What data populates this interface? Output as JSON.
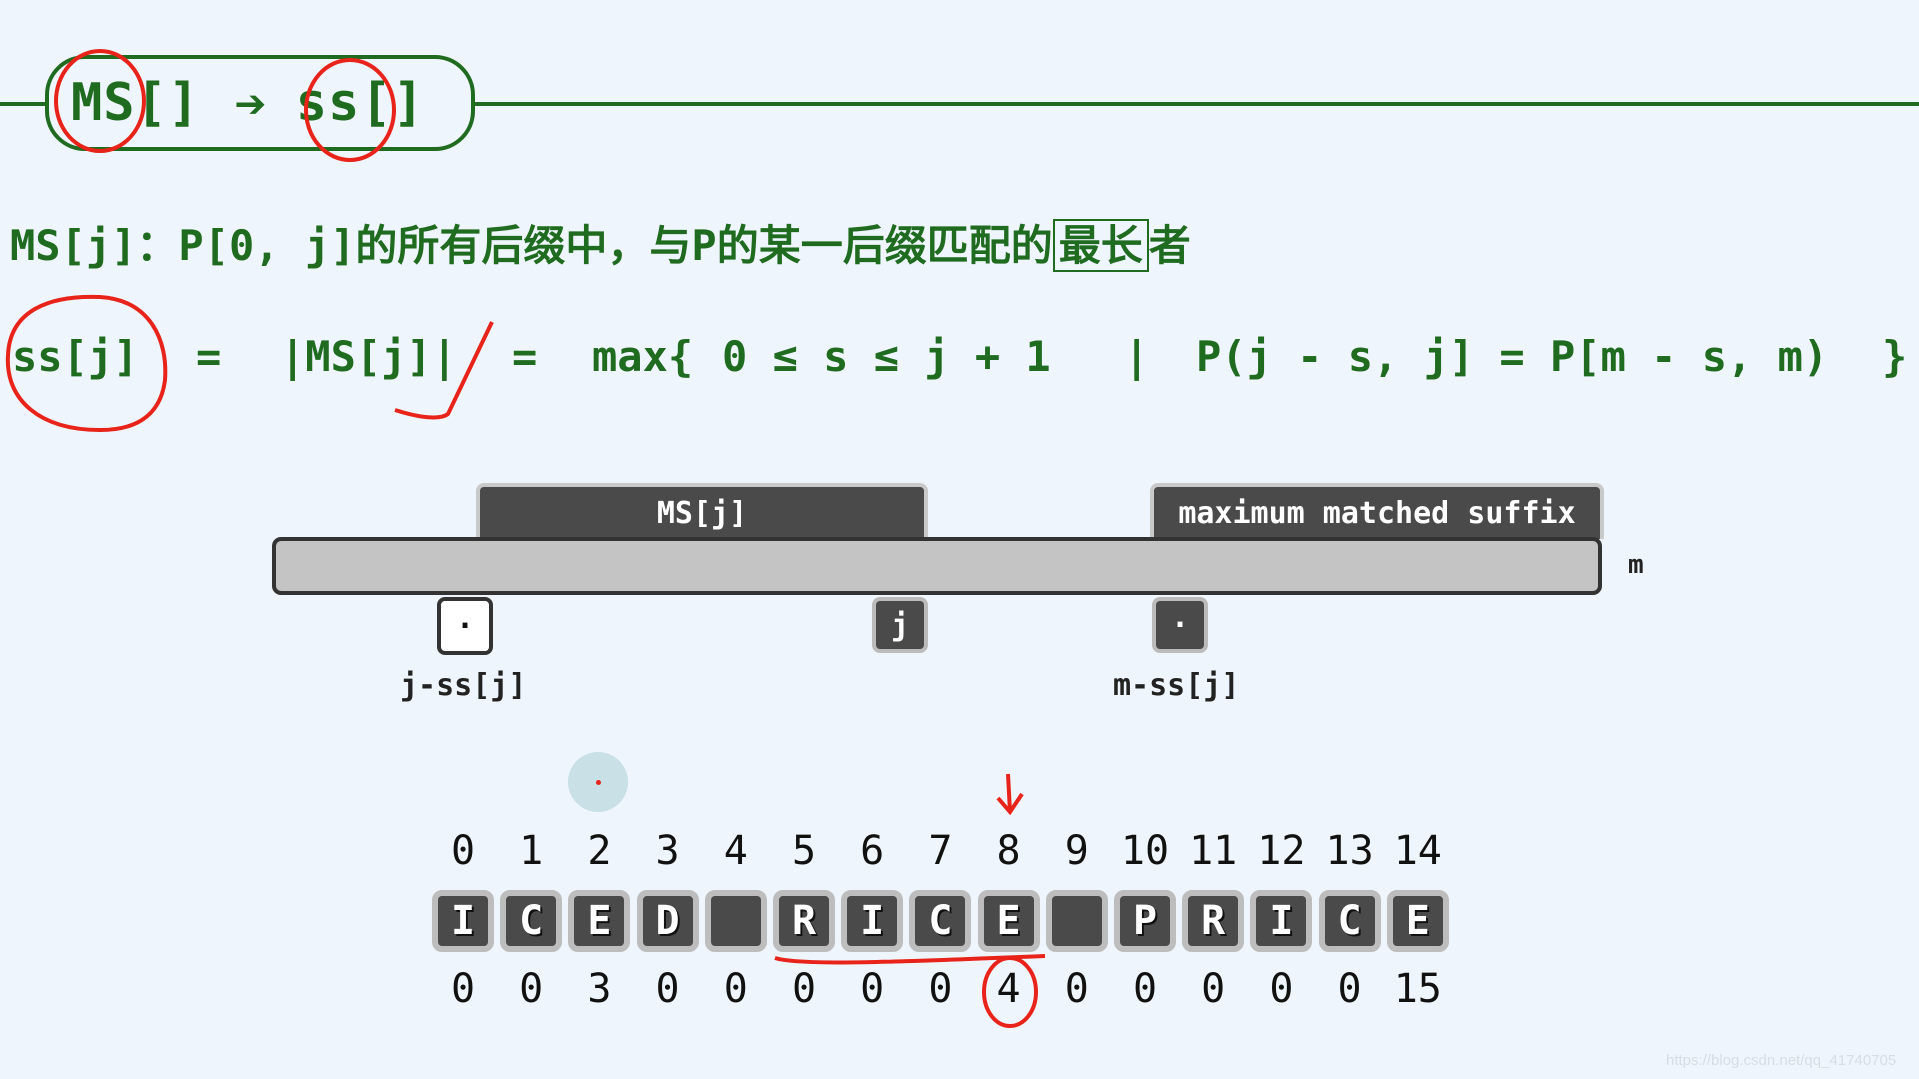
{
  "header": {
    "from": "MS[]",
    "arrow_icon": "right-arrow",
    "to": "ss[]"
  },
  "definition": {
    "prefix": "MS[j]：P[0, j]的所有后缀中，与P的某一后缀匹配的",
    "boxed": "最长",
    "suffix": "者"
  },
  "formula": {
    "lhs": "ss[j]",
    "eq1": "=",
    "abs": "|MS[j]|",
    "eq2": "=",
    "max_open": "max{",
    "cond1": "0 ≤ s ≤ j + 1",
    "bar": "|",
    "cond2": "P(j - s, j] = P[m - s, m)",
    "close": "}"
  },
  "diagram": {
    "tab_ms": "MS[j]",
    "tab_suffix": "maximum matched suffix",
    "marker_left": "·",
    "marker_j": "j",
    "marker_right": "·",
    "label_left": "j-ss[j]",
    "label_right": "m-ss[j]",
    "label_end": "m"
  },
  "array": {
    "indices": [
      "0",
      "1",
      "2",
      "3",
      "4",
      "5",
      "6",
      "7",
      "8",
      "9",
      "10",
      "11",
      "12",
      "13",
      "14"
    ],
    "chars": [
      "I",
      "C",
      "E",
      "D",
      "",
      "R",
      "I",
      "C",
      "E",
      "",
      "P",
      "R",
      "I",
      "C",
      "E"
    ],
    "ss_values": [
      "0",
      "0",
      "3",
      "0",
      "0",
      "0",
      "0",
      "0",
      "4",
      "0",
      "0",
      "0",
      "0",
      "0",
      "15"
    ],
    "highlighted_index": 8
  },
  "watermark": "https://blog.csdn.net/qq_41740705"
}
